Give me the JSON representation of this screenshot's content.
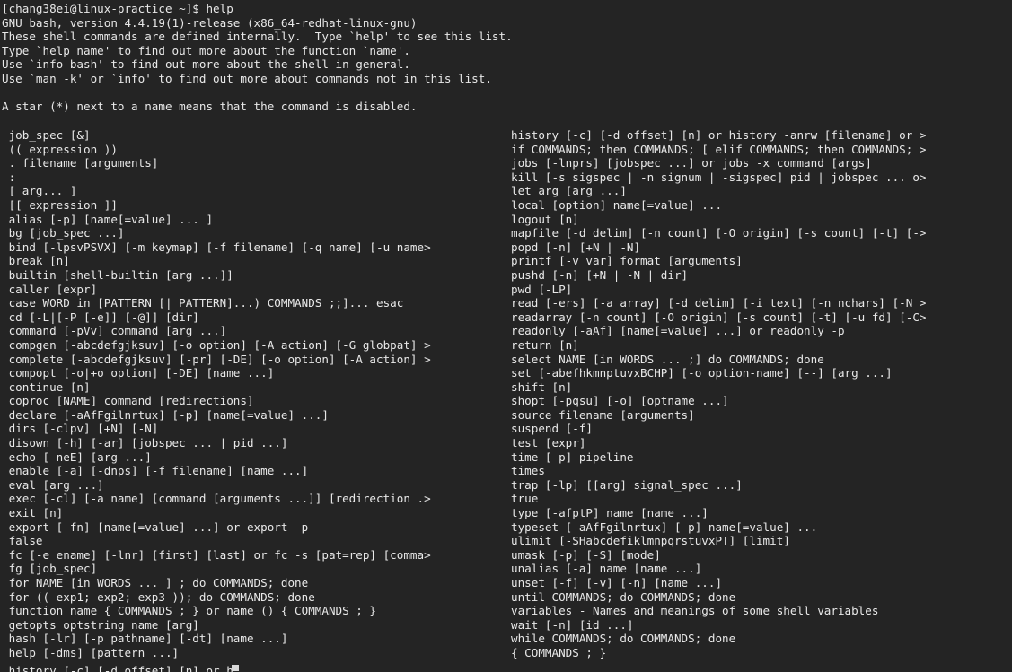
{
  "terminal": {
    "background_color": "#242424",
    "foreground_color": "#e8e8e8",
    "cursor_color": "#d8d8d8"
  },
  "prompt": {
    "line": "[chang38ei@linux-practice ~]$ help",
    "user": "chang38ei",
    "host": "linux-practice",
    "cwd": "~",
    "symbol": "$",
    "command": "help"
  },
  "header": {
    "lines": [
      "GNU bash, version 4.4.19(1)-release (x86_64-redhat-linux-gnu)",
      "These shell commands are defined internally.  Type `help' to see this list.",
      "Type `help name' to find out more about the function `name'.",
      "Use `info bash' to find out more about the shell in general.",
      "Use `man -k' or `info' to find out more about commands not in this list.",
      "",
      "A star (*) next to a name means that the command is disabled."
    ]
  },
  "left_column": [
    " job_spec [&]",
    " (( expression ))",
    " . filename [arguments]",
    " :",
    " [ arg... ]",
    " [[ expression ]]",
    " alias [-p] [name[=value] ... ]",
    " bg [job_spec ...]",
    " bind [-lpsvPSVX] [-m keymap] [-f filename] [-q name] [-u name>",
    " break [n]",
    " builtin [shell-builtin [arg ...]]",
    " caller [expr]",
    " case WORD in [PATTERN [| PATTERN]...) COMMANDS ;;]... esac",
    " cd [-L|[-P [-e]] [-@]] [dir]",
    " command [-pVv] command [arg ...]",
    " compgen [-abcdefgjksuv] [-o option] [-A action] [-G globpat] >",
    " complete [-abcdefgjksuv] [-pr] [-DE] [-o option] [-A action] >",
    " compopt [-o|+o option] [-DE] [name ...]",
    " continue [n]",
    " coproc [NAME] command [redirections]",
    " declare [-aAfFgilnrtux] [-p] [name[=value] ...]",
    " dirs [-clpv] [+N] [-N]",
    " disown [-h] [-ar] [jobspec ... | pid ...]",
    " echo [-neE] [arg ...]",
    " enable [-a] [-dnps] [-f filename] [name ...]",
    " eval [arg ...]",
    " exec [-cl] [-a name] [command [arguments ...]] [redirection .>",
    " exit [n]",
    " export [-fn] [name[=value] ...] or export -p",
    " false",
    " fc [-e ename] [-lnr] [first] [last] or fc -s [pat=rep] [comma>",
    " fg [job_spec]",
    " for NAME [in WORDS ... ] ; do COMMANDS; done",
    " for (( exp1; exp2; exp3 )); do COMMANDS; done",
    " function name { COMMANDS ; } or name () { COMMANDS ; }",
    " getopts optstring name [arg]",
    " hash [-lr] [-p pathname] [-dt] [name ...]",
    " help [-dms] [pattern ...]"
  ],
  "right_column": [
    "history [-c] [-d offset] [n] or history -anrw [filename] or >",
    "if COMMANDS; then COMMANDS; [ elif COMMANDS; then COMMANDS; >",
    "jobs [-lnprs] [jobspec ...] or jobs -x command [args]",
    "kill [-s sigspec | -n signum | -sigspec] pid | jobspec ... o>",
    "let arg [arg ...]",
    "local [option] name[=value] ...",
    "logout [n]",
    "mapfile [-d delim] [-n count] [-O origin] [-s count] [-t] [->",
    "popd [-n] [+N | -N]",
    "printf [-v var] format [arguments]",
    "pushd [-n] [+N | -N | dir]",
    "pwd [-LP]",
    "read [-ers] [-a array] [-d delim] [-i text] [-n nchars] [-N >",
    "readarray [-n count] [-O origin] [-s count] [-t] [-u fd] [-C>",
    "readonly [-aAf] [name[=value] ...] or readonly -p",
    "return [n]",
    "select NAME [in WORDS ... ;] do COMMANDS; done",
    "set [-abefhkmnptuvxBCHP] [-o option-name] [--] [arg ...]",
    "shift [n]",
    "shopt [-pqsu] [-o] [optname ...]",
    "source filename [arguments]",
    "suspend [-f]",
    "test [expr]",
    "time [-p] pipeline",
    "times",
    "trap [-lp] [[arg] signal_spec ...]",
    "true",
    "type [-afptP] name [name ...]",
    "typeset [-aAfFgilnrtux] [-p] name[=value] ...",
    "ulimit [-SHabcdefiklmnpqrstuvxPT] [limit]",
    "umask [-p] [-S] [mode]",
    "unalias [-a] name [name ...]",
    "unset [-f] [-v] [-n] [name ...]",
    "until COMMANDS; do COMMANDS; done",
    "variables - Names and meanings of some shell variables",
    "wait [-n] [id ...]",
    "while COMMANDS; do COMMANDS; done",
    "{ COMMANDS ; }"
  ],
  "cut_off_row": {
    "left": " history [-c] [-d offset] [n] or h",
    "right": "{ COMMANDS ; }"
  }
}
